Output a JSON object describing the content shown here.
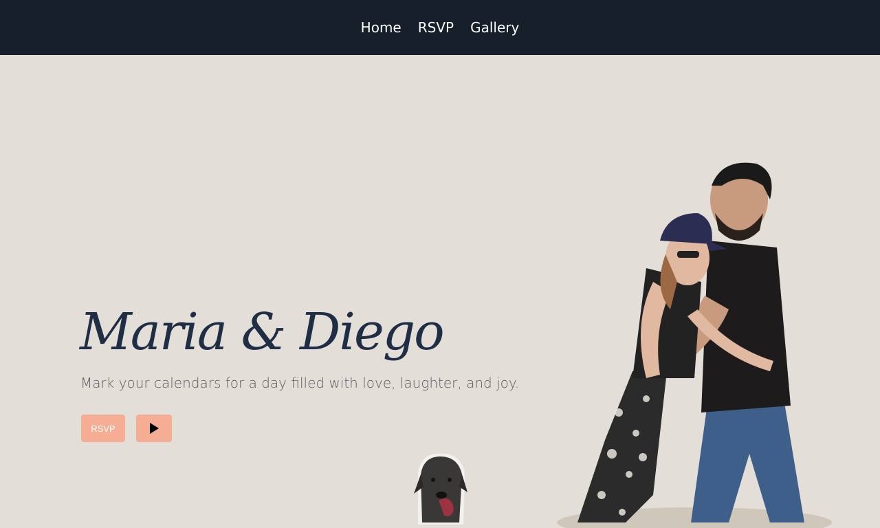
{
  "nav": {
    "items": [
      {
        "label": "Home"
      },
      {
        "label": "RSVP"
      },
      {
        "label": "Gallery"
      }
    ]
  },
  "hero": {
    "title": "Maria & Diego",
    "tagline": "Mark your calendars for a day filled with love, laughter, and joy.",
    "rsvp_button_label": "RSVP",
    "play_button_icon": "play-icon"
  },
  "images": {
    "couple_photo": "couple-photo",
    "dog_photo": "dog-photo"
  },
  "colors": {
    "nav_background": "#171f2b",
    "page_background": "#e3dfd8",
    "title_color": "#1f2d45",
    "button_color": "#f5ad93"
  }
}
